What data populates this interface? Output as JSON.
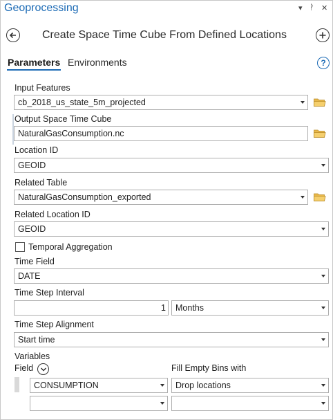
{
  "pane": {
    "title": "Geoprocessing",
    "controls": [
      "▾",
      "ᚹ",
      "✕"
    ]
  },
  "tool": {
    "title": "Create Space Time Cube From Defined Locations"
  },
  "tabs": [
    {
      "label": "Parameters",
      "active": true
    },
    {
      "label": "Environments",
      "active": false
    }
  ],
  "help_icon": "?",
  "params": {
    "input_features": {
      "label": "Input Features",
      "value": "cb_2018_us_state_5m_projected"
    },
    "output_cube": {
      "label": "Output Space Time Cube",
      "value": "NaturalGasConsumption.nc"
    },
    "location_id": {
      "label": "Location ID",
      "value": "GEOID"
    },
    "related_table": {
      "label": "Related Table",
      "value": "NaturalGasConsumption_exported"
    },
    "related_location_id": {
      "label": "Related Location ID",
      "value": "GEOID"
    },
    "temporal_aggregation": {
      "label": "Temporal Aggregation",
      "checked": false
    },
    "time_field": {
      "label": "Time Field",
      "value": "DATE"
    },
    "time_step_interval": {
      "label": "Time Step Interval",
      "number": "1",
      "unit": "Months"
    },
    "time_step_alignment": {
      "label": "Time Step Alignment",
      "value": "Start time"
    },
    "variables": {
      "label": "Variables",
      "field_header": "Field",
      "fill_header": "Fill Empty Bins with",
      "rows": [
        {
          "field": "CONSUMPTION",
          "fill": "Drop locations"
        },
        {
          "field": "",
          "fill": ""
        }
      ]
    }
  },
  "colors": {
    "accent": "#1b6ab5",
    "folder": "#e8b84a"
  }
}
